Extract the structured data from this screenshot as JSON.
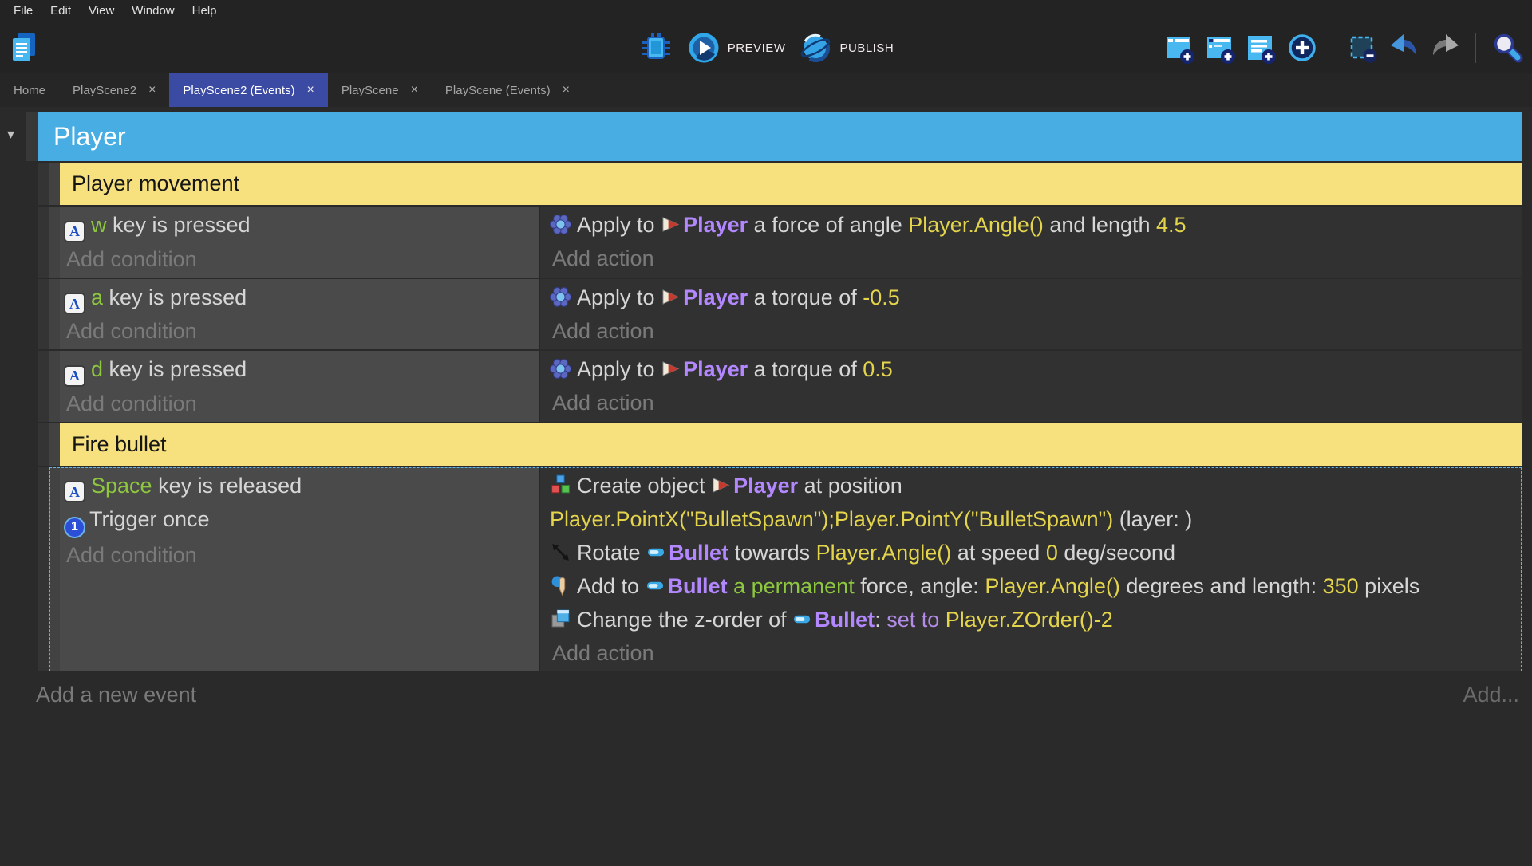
{
  "menu": {
    "items": [
      "File",
      "Edit",
      "View",
      "Window",
      "Help"
    ]
  },
  "toolbar": {
    "preview_label": "PREVIEW",
    "publish_label": "PUBLISH",
    "icons_right": [
      "add-event",
      "add-subevent",
      "add-comment",
      "add-other-event",
      "delete-selection",
      "undo",
      "redo",
      "search"
    ]
  },
  "tabs": [
    {
      "label": "Home",
      "closable": false,
      "active": false
    },
    {
      "label": "PlayScene2",
      "closable": true,
      "active": false
    },
    {
      "label": "PlayScene2 (Events)",
      "closable": true,
      "active": true
    },
    {
      "label": "PlayScene",
      "closable": true,
      "active": false
    },
    {
      "label": "PlayScene (Events)",
      "closable": true,
      "active": false
    }
  ],
  "close_glyph": "×",
  "sheet": {
    "caret_glyph": "▾",
    "group_title": "Player",
    "add_condition_label": "Add condition",
    "add_action_label": "Add action",
    "icon_glyphs": {
      "keyboard": "A",
      "trigger_once": "1"
    },
    "colors": {
      "group_header": "#47ade2",
      "comment_bg": "#f7e17f",
      "condition_bg": "#4a4a4a",
      "action_bg": "#313131",
      "object_text": "#b388ff",
      "expression_text": "#e3d44b",
      "key_text": "#8dc63f",
      "selection_dash": "#5fb6e8",
      "active_tab": "#3b4aa2"
    },
    "rows": [
      {
        "type": "comment",
        "text": "Player movement"
      },
      {
        "type": "event",
        "selected": false,
        "conditions": [
          {
            "icon": "keyboard",
            "segs": [
              [
                "g",
                "w"
              ],
              [
                "p",
                " key is pressed"
              ]
            ]
          }
        ],
        "actions": [
          {
            "icon": "physics",
            "segs": [
              [
                "p",
                "Apply to "
              ],
              [
                "i",
                "player"
              ],
              [
                "o",
                "Player"
              ],
              [
                "p",
                " a force of angle "
              ],
              [
                "y",
                "Player.Angle()"
              ],
              [
                "p",
                " and length "
              ],
              [
                "y",
                "4.5"
              ]
            ]
          }
        ]
      },
      {
        "type": "event",
        "selected": false,
        "conditions": [
          {
            "icon": "keyboard",
            "segs": [
              [
                "g",
                "a"
              ],
              [
                "p",
                " key is pressed"
              ]
            ]
          }
        ],
        "actions": [
          {
            "icon": "physics",
            "segs": [
              [
                "p",
                "Apply to "
              ],
              [
                "i",
                "player"
              ],
              [
                "o",
                "Player"
              ],
              [
                "p",
                " a torque of "
              ],
              [
                "y",
                "-0.5"
              ]
            ]
          }
        ]
      },
      {
        "type": "event",
        "selected": false,
        "conditions": [
          {
            "icon": "keyboard",
            "segs": [
              [
                "g",
                "d"
              ],
              [
                "p",
                " key is pressed"
              ]
            ]
          }
        ],
        "actions": [
          {
            "icon": "physics",
            "segs": [
              [
                "p",
                "Apply to "
              ],
              [
                "i",
                "player"
              ],
              [
                "o",
                "Player"
              ],
              [
                "p",
                " a torque of "
              ],
              [
                "y",
                "0.5"
              ]
            ]
          }
        ]
      },
      {
        "type": "comment",
        "text": "Fire bullet"
      },
      {
        "type": "event",
        "selected": true,
        "conditions": [
          {
            "icon": "keyboard",
            "segs": [
              [
                "g",
                "Space"
              ],
              [
                "p",
                " key is released"
              ]
            ]
          },
          {
            "icon": "once",
            "segs": [
              [
                "p",
                "Trigger once"
              ]
            ]
          }
        ],
        "actions": [
          {
            "icon": "create",
            "segs": [
              [
                "p",
                "Create object "
              ],
              [
                "i",
                "player"
              ],
              [
                "o",
                "Player"
              ],
              [
                "p",
                " at position"
              ]
            ]
          },
          {
            "icon": null,
            "segs": [
              [
                "y",
                "Player.PointX(\"BulletSpawn\");Player.PointY(\"BulletSpawn\")"
              ],
              [
                "p",
                " (layer: )"
              ]
            ]
          },
          {
            "icon": "rotate",
            "segs": [
              [
                "p",
                "Rotate "
              ],
              [
                "i",
                "bullet"
              ],
              [
                "o",
                "Bullet"
              ],
              [
                "p",
                " towards "
              ],
              [
                "y",
                "Player.Angle()"
              ],
              [
                "p",
                " at speed "
              ],
              [
                "y",
                "0"
              ],
              [
                "p",
                " deg/second"
              ]
            ]
          },
          {
            "icon": "force",
            "segs": [
              [
                "p",
                "Add to "
              ],
              [
                "i",
                "bullet"
              ],
              [
                "o",
                "Bullet"
              ],
              [
                "p",
                " "
              ],
              [
                "g",
                "a permanent"
              ],
              [
                "p",
                " force, angle: "
              ],
              [
                "y",
                "Player.Angle()"
              ],
              [
                "p",
                " degrees and length: "
              ],
              [
                "y",
                "350"
              ],
              [
                "p",
                " pixels"
              ]
            ]
          },
          {
            "icon": "zorder",
            "segs": [
              [
                "p",
                "Change the z-order of "
              ],
              [
                "i",
                "bullet"
              ],
              [
                "o",
                "Bullet"
              ],
              [
                "p",
                ": "
              ],
              [
                "v",
                "set to"
              ],
              [
                "p",
                " "
              ],
              [
                "y",
                "Player.ZOrder()-2"
              ]
            ]
          }
        ]
      }
    ]
  },
  "footer": {
    "add_new_event": "Add a new event",
    "add_more": "Add..."
  }
}
